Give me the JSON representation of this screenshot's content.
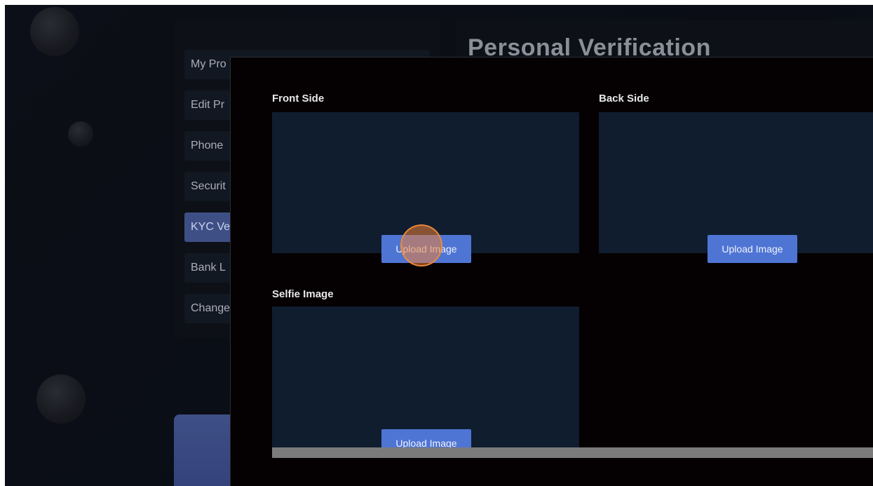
{
  "sidebar": {
    "items": [
      {
        "label": "My Pro",
        "active": false
      },
      {
        "label": "Edit Pr",
        "active": false
      },
      {
        "label": "Phone",
        "active": false
      },
      {
        "label": "Securit",
        "active": false
      },
      {
        "label": "KYC Ve",
        "active": true
      },
      {
        "label": "Bank L",
        "active": false
      },
      {
        "label": "Change",
        "active": false
      }
    ]
  },
  "content": {
    "title": "Personal Verification"
  },
  "modal": {
    "front": {
      "label": "Front Side",
      "button": "Upload Image"
    },
    "back": {
      "label": "Back Side",
      "button": "Upload Image"
    },
    "selfie": {
      "label": "Selfie Image",
      "button": "Upload Image"
    }
  },
  "colors": {
    "accent": "#4f75d4",
    "active_nav": "#3e4f86",
    "upload_box": "#0f1d2e",
    "modal_bg": "#050102",
    "click_indicator": "#ec8038"
  }
}
